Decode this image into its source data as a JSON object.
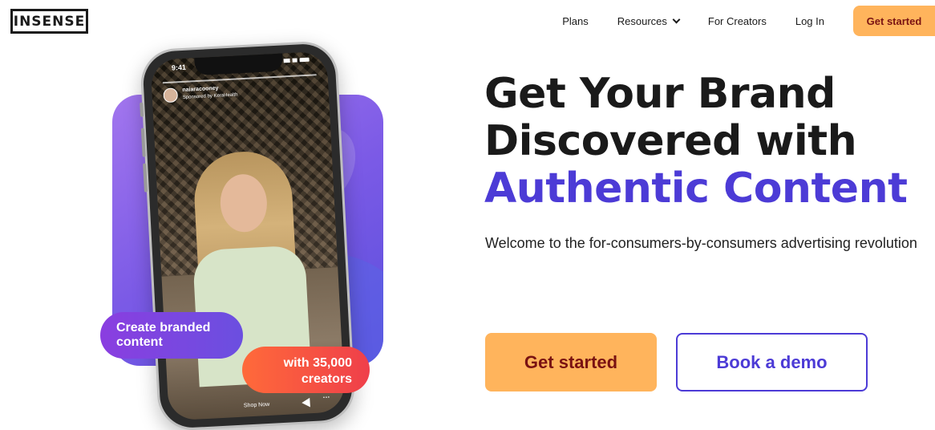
{
  "header": {
    "logo_text": "INSENSE",
    "nav": {
      "plans": "Plans",
      "resources": "Resources",
      "for_creators": "For Creators",
      "log_in": "Log In",
      "get_started": "Get started"
    }
  },
  "phone": {
    "status_time": "9:41",
    "username": "naiaracooney",
    "sponsored": "Sponsored by KeraHealth",
    "cta": "Shop Now",
    "more": "···"
  },
  "badges": {
    "left": "Create branded content",
    "right": "with 35,000 creators"
  },
  "hero": {
    "headline_line1": "Get Your Brand",
    "headline_line2": "Discovered with",
    "headline_accent": "Authentic Content",
    "subtitle": "Welcome to the for-consumers-by-consumers advertising revolution",
    "primary_button": "Get started",
    "secondary_button": "Book a demo"
  },
  "colors": {
    "accent": "#4c3bd6",
    "cta_orange": "#ffb45c",
    "cta_text": "#7a1212",
    "purple_card": "#7b5ae6"
  }
}
